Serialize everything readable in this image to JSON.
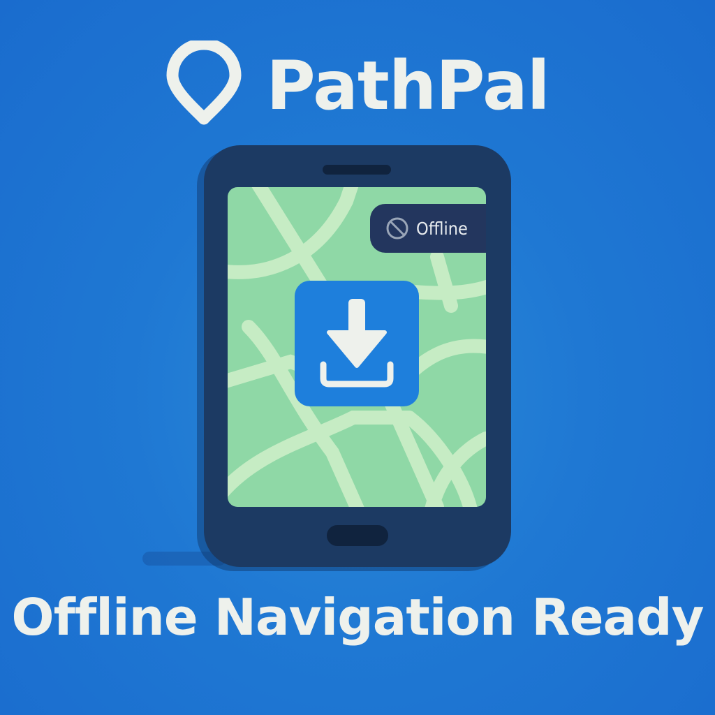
{
  "brand": {
    "name": "PathPal",
    "icon": "map-pin-icon"
  },
  "screen": {
    "status_badge": {
      "label": "Offline",
      "icon": "no-signal-icon"
    },
    "action_icon": "download-icon"
  },
  "tagline": "Offline Navigation Ready",
  "colors": {
    "background": "#1f78d3",
    "phone_body": "#1c3a63",
    "map_fill": "#8fd8a6",
    "map_roads": "#c6ecc4",
    "badge_bg": "#23365e",
    "accent_tile": "#1e7fdc",
    "text_light": "#eef1ec"
  }
}
